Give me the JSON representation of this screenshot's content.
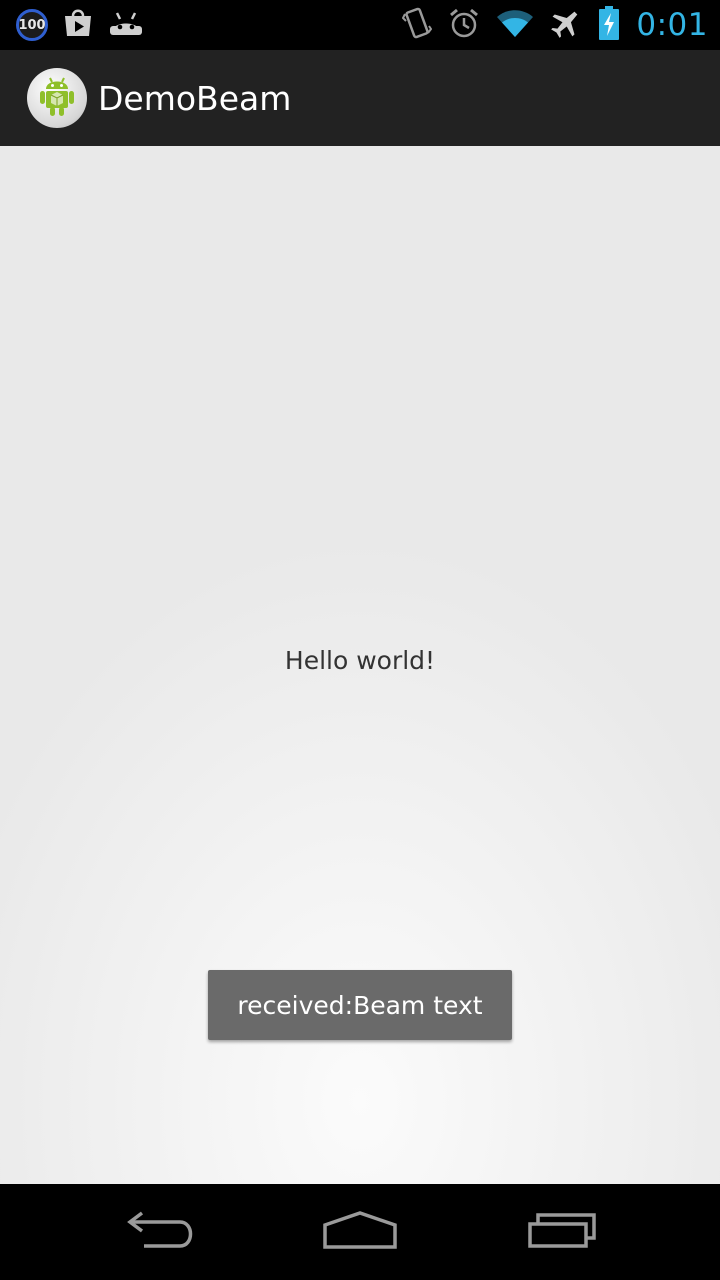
{
  "status_bar": {
    "battery_badge": "100",
    "time": "0:01",
    "icons": [
      "notification-100-icon",
      "play-store-icon",
      "android-debug-icon",
      "vibrate-icon",
      "alarm-icon",
      "wifi-icon",
      "airplane-mode-icon",
      "battery-charging-icon"
    ],
    "accent_color": "#33b5e5"
  },
  "action_bar": {
    "title": "DemoBeam",
    "icon": "android-robot-icon"
  },
  "content": {
    "text": "Hello world!"
  },
  "toast": {
    "text": "received:Beam text"
  },
  "nav_bar": {
    "icons": [
      "back-icon",
      "home-icon",
      "recent-apps-icon"
    ]
  }
}
